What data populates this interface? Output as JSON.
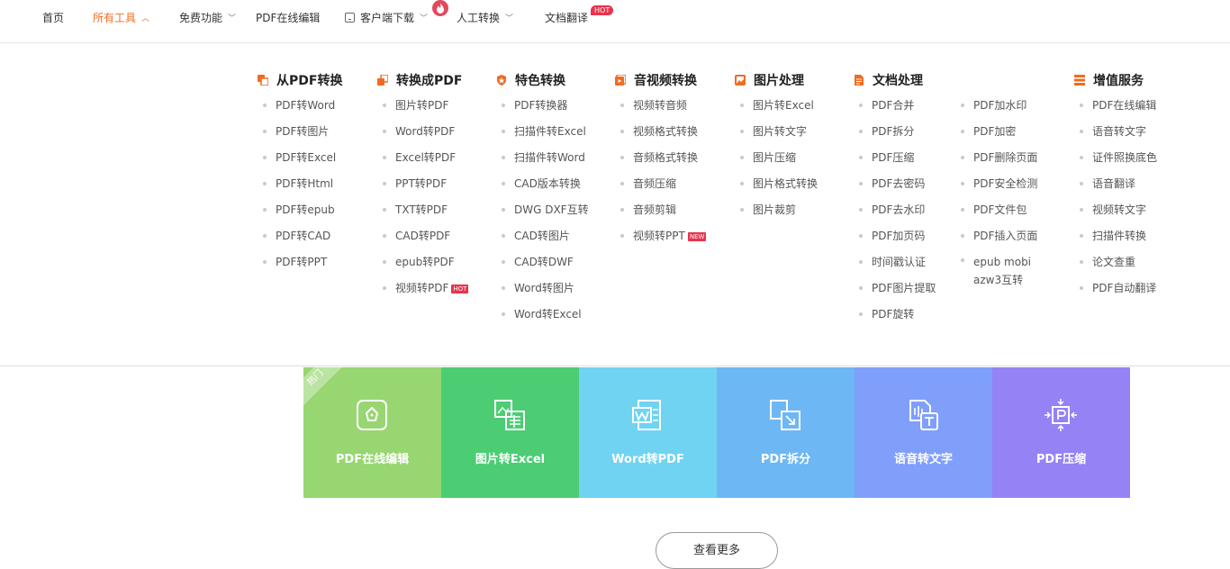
{
  "nav": {
    "items": [
      {
        "label": "首页"
      },
      {
        "label": "所有工具"
      },
      {
        "label": "免费功能"
      },
      {
        "label": "PDF在线编辑"
      },
      {
        "label": "客户端下载"
      },
      {
        "label": "人工转换"
      },
      {
        "label": "文档翻译"
      }
    ],
    "hot_badge": "HOT",
    "accent": "#f26b22"
  },
  "menu": {
    "columns": [
      {
        "title": "从PDF转换",
        "icon": "pdf-from-icon",
        "items": [
          "PDF转Word",
          "PDF转图片",
          "PDF转Excel",
          "PDF转Html",
          "PDF转epub",
          "PDF转CAD",
          "PDF转PPT"
        ]
      },
      {
        "title": "转换成PDF",
        "icon": "pdf-to-icon",
        "items": [
          "图片转PDF",
          "Word转PDF",
          "Excel转PDF",
          "PPT转PDF",
          "TXT转PDF",
          "CAD转PDF",
          "epub转PDF",
          "视频转PDF"
        ],
        "tags": {
          "7": "HOT"
        }
      },
      {
        "title": "特色转换",
        "icon": "shield-icon",
        "items": [
          "PDF转换器",
          "扫描件转Excel",
          "扫描件转Word",
          "CAD版本转换",
          "DWG DXF互转",
          "CAD转图片",
          "CAD转DWF",
          "Word转图片",
          "Word转Excel"
        ]
      },
      {
        "title": "音视频转换",
        "icon": "video-icon",
        "items": [
          "视频转音频",
          "视频格式转换",
          "音频格式转换",
          "音频压缩",
          "音频剪辑",
          "视频转PPT"
        ],
        "tags": {
          "5": "NEW"
        }
      },
      {
        "title": "图片处理",
        "icon": "image-icon",
        "items": [
          "图片转Excel",
          "图片转文字",
          "图片压缩",
          "图片格式转换",
          "图片裁剪"
        ]
      },
      {
        "title": "文档处理",
        "icon": "document-icon",
        "items": [
          "PDF合并",
          "PDF拆分",
          "PDF压缩",
          "PDF去密码",
          "PDF去水印",
          "PDF加页码",
          "时间戳认证",
          "PDF图片提取",
          "PDF旋转"
        ]
      },
      {
        "title": "",
        "icon": "",
        "items": [
          "PDF加水印",
          "PDF加密",
          "PDF删除页面",
          "PDF安全检测",
          "PDF文件包",
          "PDF插入页面",
          "epub mobi azw3互转"
        ]
      },
      {
        "title": "增值服务",
        "icon": "list-icon",
        "items": [
          "PDF在线编辑",
          "语音转文字",
          "证件照换底色",
          "语音翻译",
          "视频转文字",
          "扫描件转换",
          "论文查重",
          "PDF自动翻译"
        ]
      }
    ]
  },
  "tiles": [
    {
      "label": "PDF在线编辑",
      "color": "#97d670",
      "icon": "edit-icon"
    },
    {
      "label": "图片转Excel",
      "color": "#4ccd74",
      "icon": "image-excel-icon"
    },
    {
      "label": "Word转PDF",
      "color": "#70d3f2",
      "icon": "word-icon"
    },
    {
      "label": "PDF拆分",
      "color": "#6db7f4",
      "icon": "split-icon"
    },
    {
      "label": "语音转文字",
      "color": "#7f9ffb",
      "icon": "voice-text-icon"
    },
    {
      "label": "PDF压缩",
      "color": "#9582f5",
      "icon": "compress-icon"
    }
  ],
  "ribbon_text": "热门",
  "more_button": "查看更多"
}
